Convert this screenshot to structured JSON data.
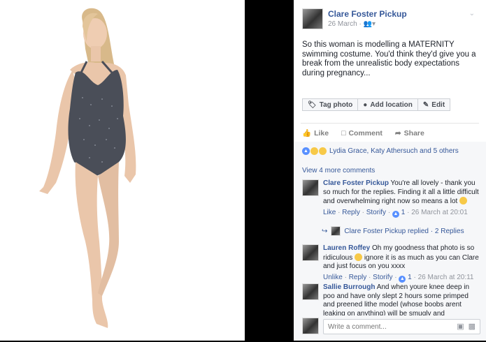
{
  "post": {
    "author": "Clare Foster Pickup",
    "date": "26 March",
    "privacy_icon": "friends-icon",
    "text": "So this woman is modelling a MATERNITY swimming costume. You'd think they'd give you a break from the unrealistic body expectations during pregnancy...",
    "actions": {
      "tag_photo": "Tag photo",
      "add_location": "Add location",
      "edit": "Edit"
    },
    "ufi": {
      "like": "Like",
      "comment": "Comment",
      "share": "Share"
    },
    "reactions_text": "Lydia Grace, Katy Athersuch and 5 others",
    "view_more_comments": "View 4 more comments"
  },
  "comments": [
    {
      "name": "Clare Foster Pickup",
      "text": "You're all lovely - thank you so much for the replies. Finding it all a little difficult and overwhelming right now so means a lot",
      "actions": {
        "like": "Like",
        "reply": "Reply",
        "storify": "Storify",
        "likes": "1",
        "time": "26 March at 20:01"
      }
    },
    {
      "name": "Lauren Roffey",
      "text_a": "Oh my goodness that photo is so ridiculous",
      "text_b": "ignore it is as much as you can Clare and just focus on you xxxx",
      "actions": {
        "like": "Unlike",
        "reply": "Reply",
        "storify": "Storify",
        "likes": "1",
        "time": "26 March at 20:11"
      }
    },
    {
      "name": "Sallie Burrough",
      "text": "And when youre knee deep in poo and have only slept 2 hours some primped and preened lithe model (whose boobs arent leaking on anything) will be smugly and unrealistically"
    }
  ],
  "reply_summary": "Clare Foster Pickup replied · 2 Replies",
  "composer": {
    "placeholder": "Write a comment..."
  },
  "colors": {
    "link": "#365899",
    "meta": "#90949c",
    "swimsuit": "#4a4e58"
  }
}
